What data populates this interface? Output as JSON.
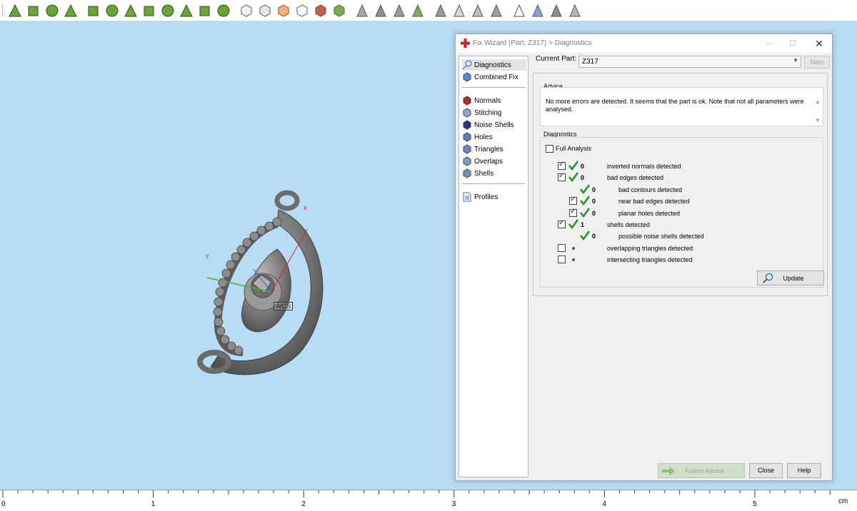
{
  "toolbar": {
    "icons": [
      "mesh-select-icon",
      "triangle-select-icon",
      "surface-select-icon",
      "sphere-select-icon",
      "plane-select-icon",
      "shell-select-icon",
      "edge-select-icon",
      "mesh-flat-icon",
      "connected-select-icon",
      "noise-select-icon",
      "radial-select-icon",
      "shell-part-icon",
      "box-view-front-icon",
      "box-view-top-icon",
      "box-view-color-icon",
      "box-view-wire-icon",
      "box-view-red-icon",
      "box-view-green-icon",
      "triangle-gray-icon",
      "triangle-dark-icon",
      "triangle-edge-icon",
      "triangle-green-icon",
      "triangle-remove-icon",
      "triangle-light-icon",
      "triangle-fold-icon",
      "triangle-flat-icon",
      "triangle-outline-icon",
      "triangle-blue-icon",
      "triangle-view-icon",
      "triangle-shade-icon"
    ],
    "accent": "#6aa53a"
  },
  "viewport": {
    "background": "#b9dcf5",
    "axis_labels": {
      "x": "x",
      "y": "y",
      "wcs": "WCS"
    }
  },
  "ruler": {
    "ticks": [
      "0",
      "1",
      "2",
      "3",
      "4",
      "5"
    ],
    "unit": "cm"
  },
  "dialog": {
    "title": "Fix Wizard (Part: Z317) > Diagnostics",
    "controls": {
      "minimize": "—",
      "maximize": "☐",
      "close": "✕"
    },
    "nav": {
      "group1": [
        {
          "label": "Diagnostics",
          "icon": "magnifier-icon",
          "selected": true
        },
        {
          "label": "Combined Fix",
          "icon": "combined-fix-icon",
          "selected": false
        }
      ],
      "group2": [
        {
          "label": "Normals",
          "icon": "normals-icon"
        },
        {
          "label": "Stitching",
          "icon": "stitching-icon"
        },
        {
          "label": "Noise Shells",
          "icon": "noise-shells-icon"
        },
        {
          "label": "Holes",
          "icon": "holes-icon"
        },
        {
          "label": "Triangles",
          "icon": "triangles-icon"
        },
        {
          "label": "Overlaps",
          "icon": "overlaps-icon"
        },
        {
          "label": "Shells",
          "icon": "shells-icon"
        }
      ],
      "group3": [
        {
          "label": "Profiles",
          "icon": "profiles-icon"
        }
      ]
    },
    "current_part": {
      "label": "Current Part:",
      "value": "Z317"
    },
    "next_label": "Next",
    "advice": {
      "title": "Advice",
      "text": "No more errors are detected. It seems that the part is ok. Note that not all parameters were analysed."
    },
    "diagnostics": {
      "title": "Diagnostics",
      "full_analysis": {
        "label": "Full Analysis",
        "checked": false
      },
      "rows": [
        {
          "checked": true,
          "status": "ok",
          "count": "0",
          "label": "inverted normals detected"
        },
        {
          "checked": true,
          "status": "ok",
          "count": "0",
          "label": "bad edges detected"
        },
        {
          "checked": null,
          "status": "ok",
          "count": "0",
          "label": "bad contours detected"
        },
        {
          "checked": true,
          "status": "ok",
          "count": "0",
          "label": "near bad edges detected"
        },
        {
          "checked": true,
          "status": "ok",
          "count": "0",
          "label": "planar holes detected"
        },
        {
          "checked": true,
          "status": "ok",
          "count": "1",
          "label": "shells detected"
        },
        {
          "checked": null,
          "status": "ok",
          "count": "0",
          "label": "possible noise shells detected"
        },
        {
          "checked": false,
          "status": "pending",
          "count": "",
          "label": "overlapping triangles detected"
        },
        {
          "checked": false,
          "status": "pending",
          "count": "",
          "label": "intersecting triangles detected"
        }
      ],
      "update_label": "Update"
    },
    "buttons": {
      "follow_advice": "Follow Advice",
      "close": "Close",
      "help": "Help"
    }
  }
}
